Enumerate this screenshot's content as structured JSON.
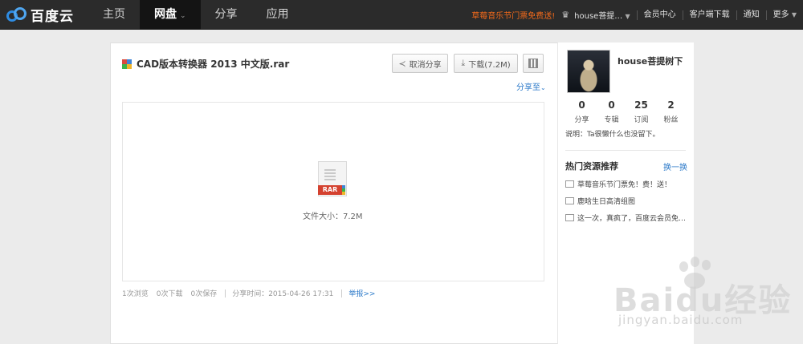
{
  "brand": {
    "logo_text": "百度云"
  },
  "nav": {
    "items": [
      {
        "label": "主页"
      },
      {
        "label": "网盘",
        "active": true
      },
      {
        "label": "分享"
      },
      {
        "label": "应用"
      }
    ],
    "caret": "⌄"
  },
  "topbar": {
    "promo": "草莓音乐节门票免费送!",
    "username": "house菩提…",
    "links": [
      "会员中心",
      "客户端下载",
      "通知",
      "更多"
    ]
  },
  "file": {
    "name": "CAD版本转换器 2013 中文版.rar",
    "type_tag": "RAR",
    "size_text": "文件大小：7.2M"
  },
  "toolbar": {
    "cancel_share_label": "取消分享",
    "download_label": "下载(7.2M)",
    "share_to_label": "分享至"
  },
  "stats": {
    "views": "1次浏览",
    "downloads": "0次下载",
    "saves": "0次保存",
    "share_time": "分享时间：2015-04-26 17:31",
    "report": "举报>>"
  },
  "profile": {
    "name": "house菩提树下",
    "counts": [
      {
        "num": "0",
        "label": "分享"
      },
      {
        "num": "0",
        "label": "专辑"
      },
      {
        "num": "25",
        "label": "订阅"
      },
      {
        "num": "2",
        "label": "粉丝"
      }
    ],
    "description": "说明：Ta很懒什么也没留下。"
  },
  "hot": {
    "title": "热门资源推荐",
    "swap_label": "换一换",
    "items": [
      "草莓音乐节门票免！费！送！",
      "鹿晗生日高清组图",
      "这一次，真疯了，百度云会员免…"
    ]
  },
  "watermark": {
    "text": "Baidu经验",
    "url": "jingyan.baidu.com"
  },
  "colors": {
    "accent": "#2c7ac9",
    "promo": "#f26a1b",
    "topbar": "#2b2b2b"
  }
}
